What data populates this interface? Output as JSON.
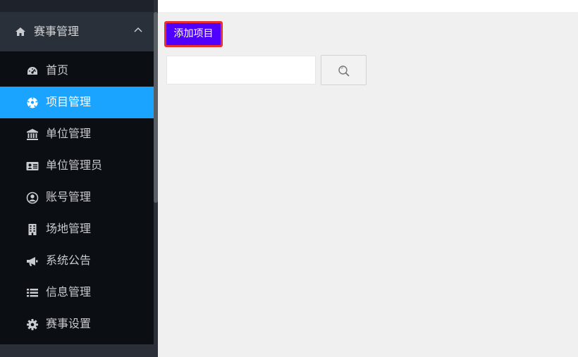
{
  "sidebar": {
    "group": {
      "label": "赛事管理",
      "icon": "home-icon",
      "expanded": true
    },
    "items": [
      {
        "label": "首页",
        "icon": "dashboard-icon",
        "active": false
      },
      {
        "label": "项目管理",
        "icon": "soccer-ball-icon",
        "active": true
      },
      {
        "label": "单位管理",
        "icon": "bank-icon",
        "active": false
      },
      {
        "label": "单位管理员",
        "icon": "id-card-icon",
        "active": false
      },
      {
        "label": "账号管理",
        "icon": "user-circle-icon",
        "active": false
      },
      {
        "label": "场地管理",
        "icon": "building-icon",
        "active": false
      },
      {
        "label": "系统公告",
        "icon": "bullhorn-icon",
        "active": false
      },
      {
        "label": "信息管理",
        "icon": "list-icon",
        "active": false
      },
      {
        "label": "赛事设置",
        "icon": "gear-icon",
        "active": false
      }
    ]
  },
  "main": {
    "add_button_label": "添加项目",
    "search": {
      "value": "",
      "placeholder": ""
    }
  },
  "colors": {
    "sidebar_bg": "#0b0e13",
    "active_item": "#1aa3ff",
    "add_button": "#5000ff",
    "highlight_border": "#e8302e"
  }
}
